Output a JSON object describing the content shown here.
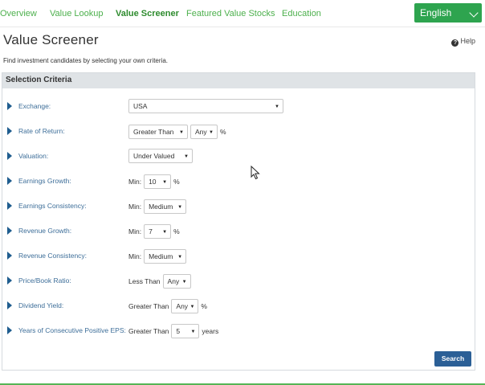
{
  "nav": {
    "items": [
      "Overview",
      "Value Lookup",
      "Value Screener",
      "Featured Value Stocks",
      "Education"
    ],
    "active_index": 2,
    "language": "English"
  },
  "header": {
    "title": "Value Screener",
    "help": "Help",
    "subtitle": "Find investment candidates by selecting your own criteria."
  },
  "panel": {
    "title": "Selection Criteria"
  },
  "criteria": {
    "exchange": {
      "label": "Exchange:",
      "value": "USA"
    },
    "rate_of_return": {
      "label": "Rate of Return:",
      "comparator": "Greater Than",
      "value": "Any",
      "unit": "%"
    },
    "valuation": {
      "label": "Valuation:",
      "value": "Under Valued"
    },
    "earnings_growth": {
      "label": "Earnings Growth:",
      "prefix": "Min:",
      "value": "10",
      "unit": "%"
    },
    "earnings_consistency": {
      "label": "Earnings Consistency:",
      "prefix": "Min:",
      "value": "Medium"
    },
    "revenue_growth": {
      "label": "Revenue Growth:",
      "prefix": "Min:",
      "value": "7",
      "unit": "%"
    },
    "revenue_consistency": {
      "label": "Revenue Consistency:",
      "prefix": "Min:",
      "value": "Medium"
    },
    "price_book": {
      "label": "Price/Book Ratio:",
      "prefix": "Less Than",
      "value": "Any"
    },
    "dividend_yield": {
      "label": "Dividend Yield:",
      "prefix": "Greater Than",
      "value": "Any",
      "unit": "%"
    },
    "positive_eps": {
      "label": "Years of Consecutive Positive EPS:",
      "prefix": "Greater Than",
      "value": "5",
      "unit": "years"
    }
  },
  "actions": {
    "search": "Search"
  },
  "colors": {
    "brand_green": "#2ea44f",
    "link_blue": "#3d6e99",
    "button_blue": "#2b5f96"
  }
}
